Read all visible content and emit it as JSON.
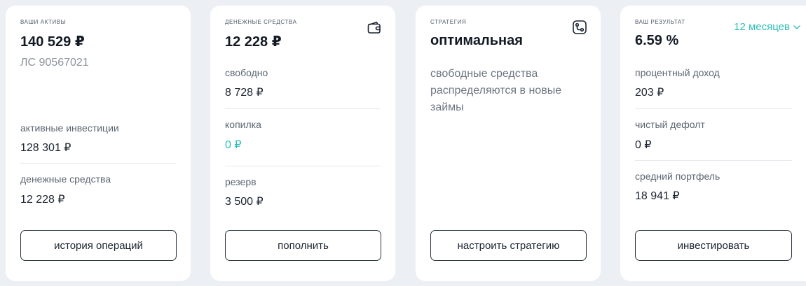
{
  "assets_card": {
    "caption": "ваши активы",
    "total": "140 529 ₽",
    "account": "ЛС 90567021",
    "rows": [
      {
        "label": "активные инвестиции",
        "value": "128 301 ₽"
      },
      {
        "label": "денежные средства",
        "value": "12 228 ₽"
      }
    ],
    "button": "история операций"
  },
  "cash_card": {
    "caption": "денежные средства",
    "icon": "wallet-icon",
    "total": "12 228 ₽",
    "rows": [
      {
        "label": "свободно",
        "value": "8 728 ₽"
      },
      {
        "label": "копилка",
        "value": "0 ₽"
      },
      {
        "label": "резерв",
        "value": "3 500 ₽"
      }
    ],
    "button": "пополнить"
  },
  "strategy_card": {
    "caption": "стратегия",
    "icon": "strategy-icon",
    "title": "оптимальная",
    "description": "свободные средства распределяются в новые займы",
    "button": "настроить стратегию"
  },
  "result_card": {
    "caption": "ваш результат",
    "period_selector": "12 месяцев",
    "total": "6.59 %",
    "rows": [
      {
        "label": "процентный доход",
        "value": "203 ₽"
      },
      {
        "label": "чистый дефолт",
        "value": "0 ₽"
      },
      {
        "label": "средний портфель",
        "value": "18 941 ₽"
      }
    ],
    "button": "инвестировать"
  },
  "colors": {
    "accent": "#2fbfb8",
    "background": "#eceff3",
    "card": "#ffffff",
    "text": "#1c2430"
  }
}
